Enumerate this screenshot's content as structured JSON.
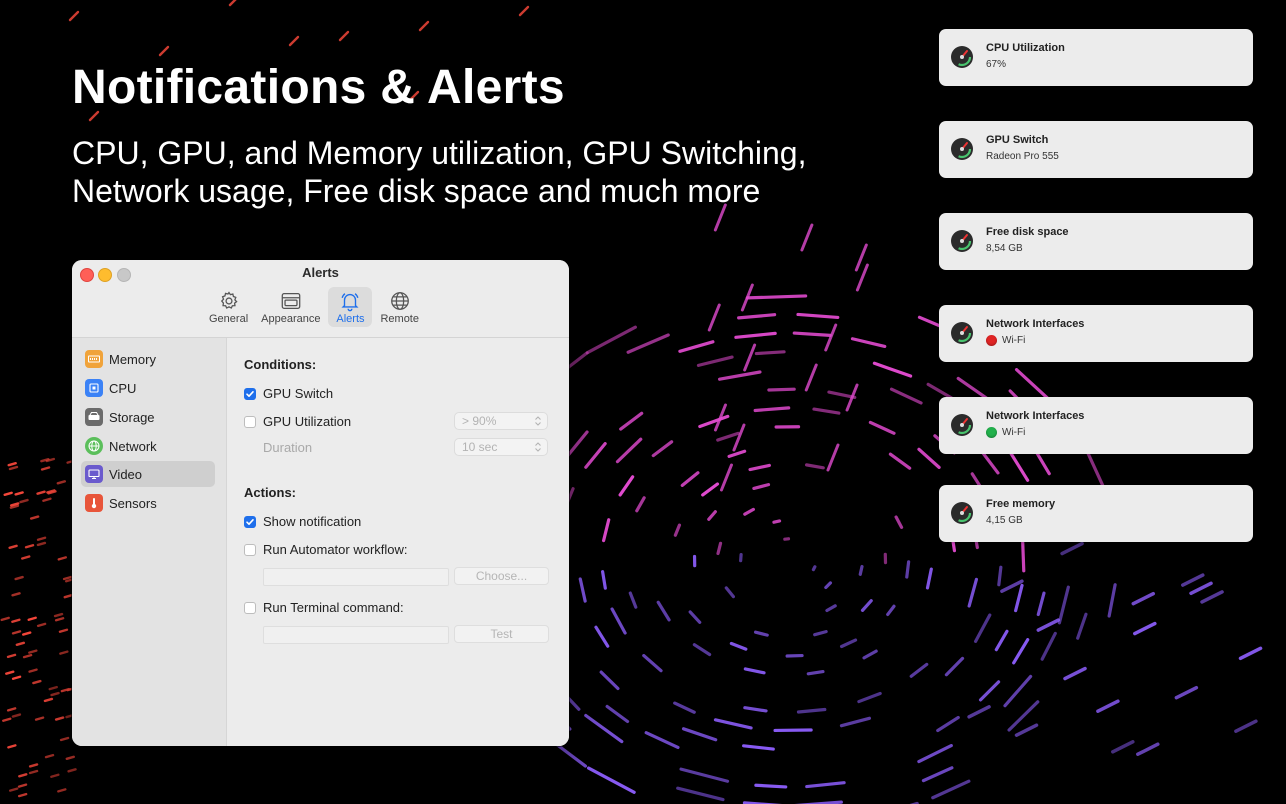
{
  "hero": {
    "title": "Notifications & Alerts",
    "subtitle_line1": "CPU, GPU, and Memory utilization, GPU Switching,",
    "subtitle_line2": "Network usage, Free disk space and much more"
  },
  "window": {
    "title": "Alerts",
    "toolbar": [
      {
        "label": "General",
        "icon": "gear-icon"
      },
      {
        "label": "Appearance",
        "icon": "window-icon"
      },
      {
        "label": "Alerts",
        "icon": "bell-icon",
        "active": true
      },
      {
        "label": "Remote",
        "icon": "globe-icon"
      }
    ],
    "sidebar": [
      {
        "label": "Memory",
        "icon": "memory-icon",
        "color": "#f0a33a"
      },
      {
        "label": "CPU",
        "icon": "cpu-icon",
        "color": "#3b82f6"
      },
      {
        "label": "Storage",
        "icon": "storage-icon",
        "color": "#6b6b6b"
      },
      {
        "label": "Network",
        "icon": "network-icon",
        "color": "#5bbf5b"
      },
      {
        "label": "Video",
        "icon": "display-icon",
        "color": "#6a5acd",
        "selected": true
      },
      {
        "label": "Sensors",
        "icon": "thermometer-icon",
        "color": "#e8553a"
      }
    ],
    "conditions": {
      "title": "Conditions:",
      "gpu_switch": {
        "label": "GPU Switch",
        "checked": true
      },
      "gpu_utilization": {
        "label": "GPU Utilization",
        "checked": false,
        "value": "> 90%"
      },
      "duration": {
        "label": "Duration",
        "value": "10 sec"
      }
    },
    "actions": {
      "title": "Actions:",
      "show_notification": {
        "label": "Show notification",
        "checked": true
      },
      "run_automator": {
        "label": "Run Automator workflow:",
        "checked": false,
        "button": "Choose..."
      },
      "run_terminal": {
        "label": "Run Terminal command:",
        "checked": false,
        "button": "Test"
      }
    }
  },
  "notifications": [
    {
      "title": "CPU Utilization",
      "body": "67%"
    },
    {
      "title": "GPU Switch",
      "body": "Radeon Pro 555"
    },
    {
      "title": "Free disk space",
      "body": "8,54 GB"
    },
    {
      "title": "Network Interfaces",
      "body": "Wi-Fi",
      "status": "red"
    },
    {
      "title": "Network Interfaces",
      "body": "Wi-Fi",
      "status": "green"
    },
    {
      "title": "Free memory",
      "body": "4,15 GB"
    }
  ],
  "colors": {
    "accent": "#1f6feb",
    "status_red": "#e02424",
    "status_green": "#22b14c",
    "art_pink": "#e24bd0",
    "art_violet": "#8a5cf6",
    "art_red": "#ff4a3d"
  }
}
